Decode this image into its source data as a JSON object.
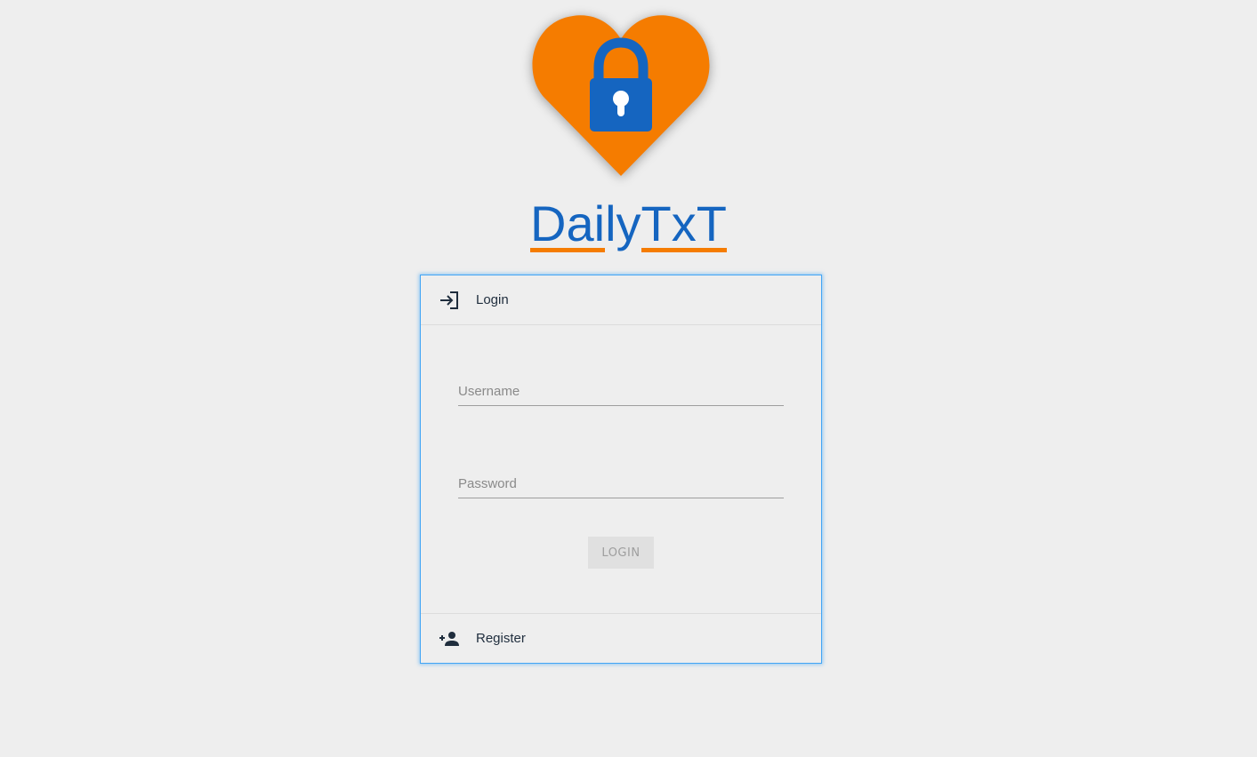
{
  "app": {
    "title": "DailyTxT",
    "title_parts": [
      "Dai",
      "ly",
      "TxT"
    ],
    "colors": {
      "brand_blue": "#1565c0",
      "brand_orange": "#f57c00",
      "panel_border": "#42a5f5",
      "background": "#eeeeee"
    }
  },
  "logo": {
    "icon": "heart-lock-icon"
  },
  "login_section": {
    "label": "Login",
    "icon": "login-icon",
    "username_placeholder": "Username",
    "username_value": "",
    "password_placeholder": "Password",
    "password_value": "",
    "button_label": "LOGIN"
  },
  "register_section": {
    "label": "Register",
    "icon": "add-user-icon"
  }
}
